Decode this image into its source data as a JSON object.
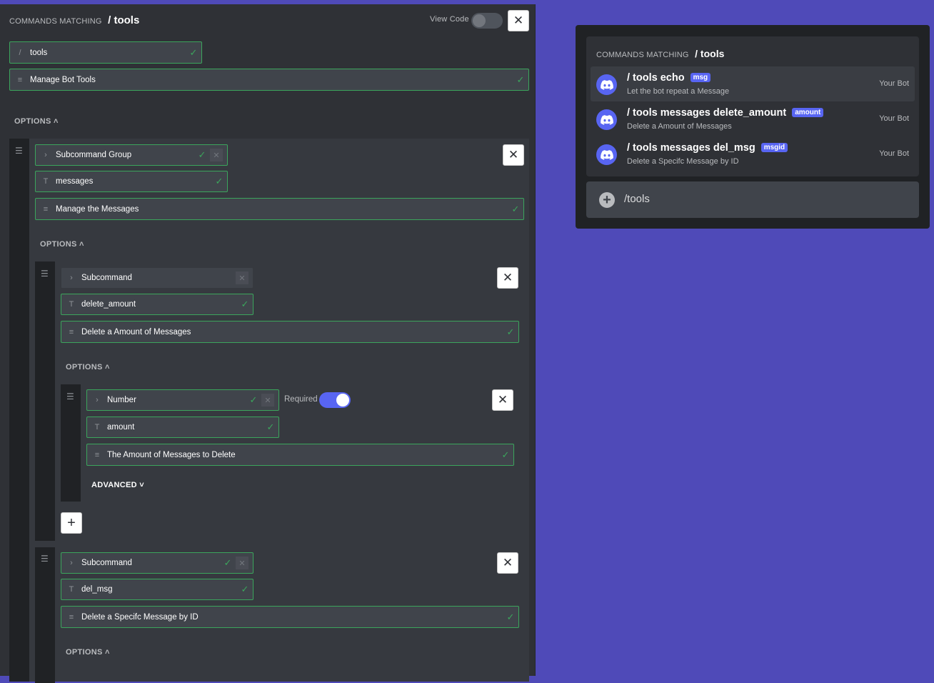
{
  "editor": {
    "header_prefix": "COMMANDS MATCHING",
    "header_command": "/ tools",
    "view_code_label": "View Code",
    "name_prefix": "/",
    "name_value": "tools",
    "description_value": "Manage Bot Tools",
    "options_label": "OPTIONS",
    "group": {
      "type_label": "Subcommand Group",
      "name_value": "messages",
      "description_value": "Manage the Messages",
      "options_label": "OPTIONS"
    },
    "subcommand1": {
      "type_label": "Subcommand",
      "name_value": "delete_amount",
      "description_value": "Delete a Amount of Messages",
      "options_label": "OPTIONS",
      "option": {
        "type_label": "Number",
        "required_label": "Required",
        "name_value": "amount",
        "description_value": "The Amount of Messages to Delete",
        "advanced_label": "ADVANCED"
      }
    },
    "subcommand2": {
      "type_label": "Subcommand",
      "name_value": "del_msg",
      "description_value": "Delete a Specifc Message by ID",
      "options_label": "OPTIONS"
    }
  },
  "preview": {
    "header_prefix": "COMMANDS MATCHING",
    "header_command": "/ tools",
    "commands": [
      {
        "name": "/ tools echo",
        "badge": "msg",
        "description": "Let the bot repeat a Message",
        "source": "Your Bot"
      },
      {
        "name": "/ tools messages delete_amount",
        "badge": "amount",
        "description": "Delete a Amount of Messages",
        "source": "Your Bot"
      },
      {
        "name": "/ tools messages del_msg",
        "badge": "msgid",
        "description": "Delete a Specifc Message by ID",
        "source": "Your Bot"
      }
    ],
    "input_value": "/tools"
  },
  "icons": {
    "close": "close-icon",
    "check": "check-icon",
    "drag": "drag-handle-icon",
    "chevron": "chevron-icon",
    "text": "text-icon",
    "lines": "description-icon",
    "plus": "plus-icon",
    "discord": "discord-logo-icon"
  },
  "colors": {
    "background": "#4f4ab8",
    "valid": "#3ba55c",
    "accent": "#5865f2"
  },
  "toggles": {
    "view_code": false,
    "required": true
  }
}
